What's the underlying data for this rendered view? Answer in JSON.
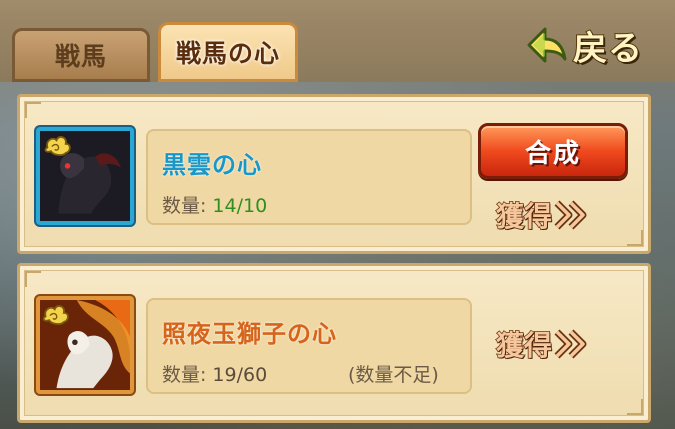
{
  "tabs": [
    {
      "label": "戦馬",
      "active": false
    },
    {
      "label": "戦馬の心",
      "active": true
    }
  ],
  "back_button": {
    "label": "戻る",
    "icon": "back-arrow-icon"
  },
  "items": [
    {
      "name": "黒雲の心",
      "quantity_label": "数量:",
      "quantity_value": "14/10",
      "compose_label": "合成",
      "obtain_label": "獲得",
      "frame_color": "#2aa7d2",
      "status_text": ""
    },
    {
      "name": "照夜玉獅子の心",
      "quantity_label": "数量:",
      "quantity_value": "19/60",
      "status_text": "(数量不足)",
      "obtain_label": "獲得",
      "frame_color": "#e0963a"
    }
  ],
  "colors": {
    "accent_blue": "#1898c8",
    "accent_orange": "#d6641a",
    "sufficient_green": "#2f8f1e",
    "compose_red": "#f04a1e"
  }
}
